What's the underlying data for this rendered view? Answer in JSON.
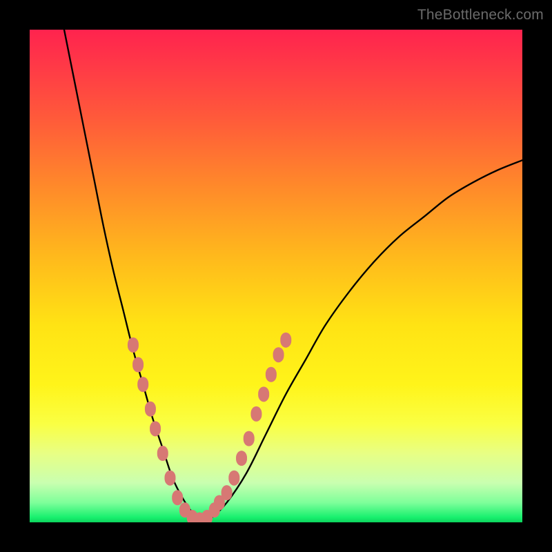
{
  "watermark": {
    "text": "TheBottleneck.com"
  },
  "chart_data": {
    "type": "line",
    "title": "",
    "xlabel": "",
    "ylabel": "",
    "xlim": [
      0,
      100
    ],
    "ylim": [
      0,
      100
    ],
    "series": [
      {
        "name": "bottleneck-curve",
        "x": [
          7,
          9,
          11,
          13,
          15,
          17,
          19,
          21,
          23,
          25,
          27,
          29,
          31,
          33,
          35,
          37,
          40,
          44,
          48,
          52,
          56,
          60,
          65,
          70,
          75,
          80,
          85,
          90,
          95,
          100
        ],
        "values": [
          100,
          90,
          80,
          70,
          60,
          51,
          43,
          35,
          28,
          21,
          15,
          9,
          5,
          2,
          0,
          1,
          4,
          10,
          18,
          26,
          33,
          40,
          47,
          53,
          58,
          62,
          66,
          69,
          71.5,
          73.5
        ]
      }
    ],
    "markers": {
      "name": "highlight-dots",
      "color": "#d77874",
      "points": [
        {
          "x": 21,
          "y": 36
        },
        {
          "x": 22,
          "y": 32
        },
        {
          "x": 23,
          "y": 28
        },
        {
          "x": 24.5,
          "y": 23
        },
        {
          "x": 25.5,
          "y": 19
        },
        {
          "x": 27,
          "y": 14
        },
        {
          "x": 28.5,
          "y": 9
        },
        {
          "x": 30,
          "y": 5
        },
        {
          "x": 31.5,
          "y": 2.5
        },
        {
          "x": 33,
          "y": 1
        },
        {
          "x": 34.5,
          "y": 0.5
        },
        {
          "x": 36,
          "y": 1
        },
        {
          "x": 37.5,
          "y": 2.5
        },
        {
          "x": 38.5,
          "y": 4
        },
        {
          "x": 40,
          "y": 6
        },
        {
          "x": 41.5,
          "y": 9
        },
        {
          "x": 43,
          "y": 13
        },
        {
          "x": 44.5,
          "y": 17
        },
        {
          "x": 46,
          "y": 22
        },
        {
          "x": 47.5,
          "y": 26
        },
        {
          "x": 49,
          "y": 30
        },
        {
          "x": 50.5,
          "y": 34
        },
        {
          "x": 52,
          "y": 37
        }
      ]
    },
    "background": {
      "gradient": [
        "#ff234e",
        "#ffe314",
        "#0dd45d"
      ],
      "direction": "vertical"
    }
  }
}
